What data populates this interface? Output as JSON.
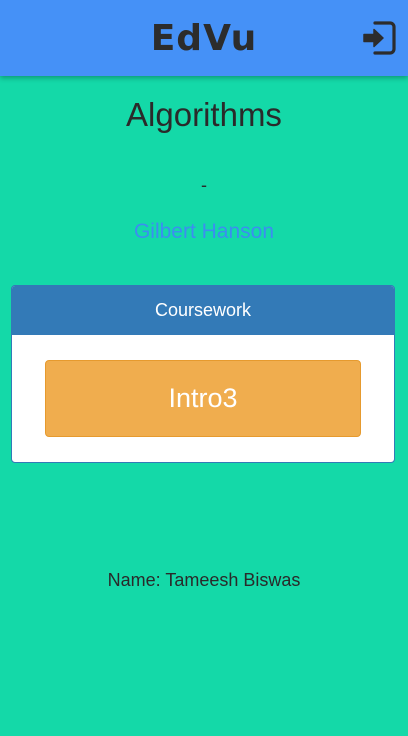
{
  "app": {
    "title": "EdVu",
    "logout_icon": "sign-in-icon"
  },
  "course": {
    "title": "Algorithms",
    "separator": "-",
    "teacher": "Gilbert Hanson"
  },
  "coursework": {
    "heading": "Coursework",
    "items": [
      {
        "label": "Intro3"
      }
    ]
  },
  "footer": {
    "name_text": "Name: Tameesh Biswas"
  },
  "colors": {
    "background": "#14d9a8",
    "app_bar": "#4591f7",
    "panel_heading": "#337ab7",
    "button_warning": "#f0ad4e",
    "link": "#3b8ef0"
  }
}
